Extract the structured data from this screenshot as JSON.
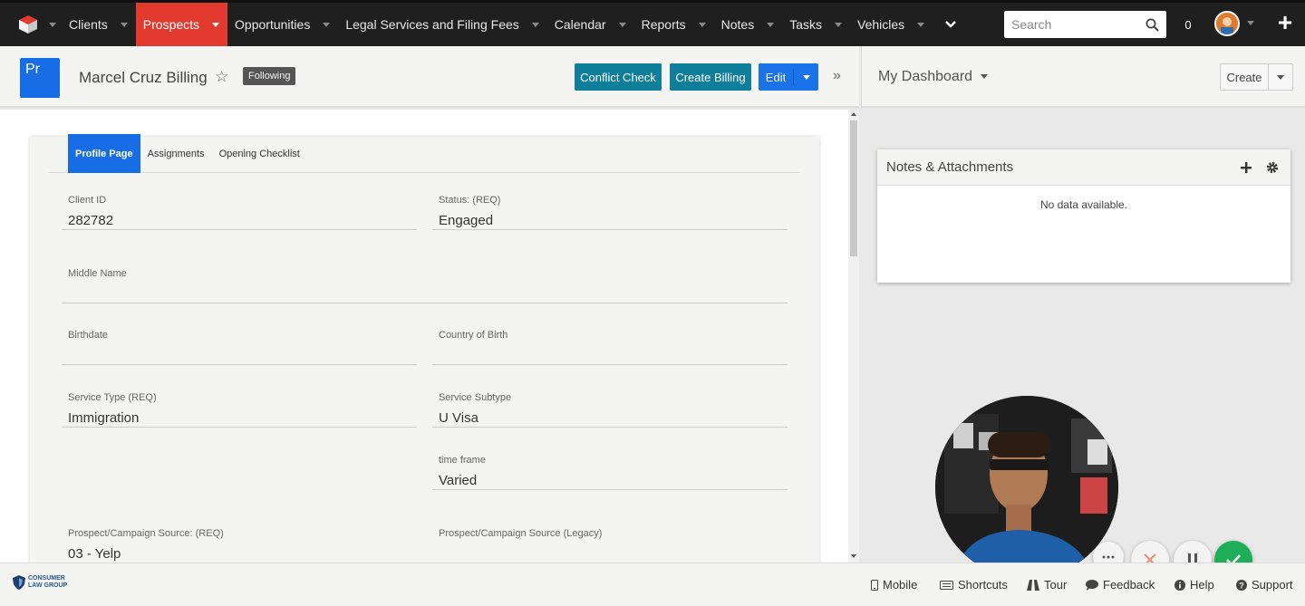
{
  "nav": {
    "items": [
      {
        "label": "Clients",
        "active": false
      },
      {
        "label": "Prospects",
        "active": true
      },
      {
        "label": "Opportunities",
        "active": false
      },
      {
        "label": "Legal Services and Filing Fees",
        "active": false
      },
      {
        "label": "Calendar",
        "active": false
      },
      {
        "label": "Reports",
        "active": false
      },
      {
        "label": "Notes",
        "active": false
      },
      {
        "label": "Tasks",
        "active": false
      },
      {
        "label": "Vehicles",
        "active": false
      }
    ],
    "search_placeholder": "Search",
    "notification_count": "0",
    "active_color": "#e23a2f"
  },
  "record": {
    "icon_text": "Pr",
    "title": "Marcel Cruz Billing",
    "following_label": "Following",
    "buttons": {
      "conflict_check": "Conflict Check",
      "create_billing": "Create Billing",
      "edit": "Edit"
    },
    "tabs": [
      "Profile Page",
      "Assignments",
      "Opening Checklist"
    ],
    "fields": {
      "client_id": {
        "label": "Client ID",
        "value": "282782"
      },
      "status": {
        "label": "Status: (REQ)",
        "value": "Engaged"
      },
      "middle_name": {
        "label": "Middle Name",
        "value": ""
      },
      "birthdate": {
        "label": "Birthdate",
        "value": ""
      },
      "country_of_birth": {
        "label": "Country of Birth",
        "value": ""
      },
      "service_type": {
        "label": "Service Type (REQ)",
        "value": "Immigration"
      },
      "service_subtype": {
        "label": "Service Subtype",
        "value": "U Visa"
      },
      "time_frame": {
        "label": "time frame",
        "value": "Varied"
      },
      "campaign_source": {
        "label": "Prospect/Campaign Source: (REQ)",
        "value": "03 - Yelp"
      },
      "campaign_source_legacy": {
        "label": "Prospect/Campaign Source (Legacy)",
        "value": ""
      }
    }
  },
  "dashboard": {
    "title": "My Dashboard",
    "create_label": "Create",
    "dashlet": {
      "title": "Notes & Attachments",
      "empty_text": "No data available."
    }
  },
  "footer": {
    "logo_text_1": "CONSUMER",
    "logo_text_2": "LAW GROUP",
    "links": {
      "mobile": "Mobile",
      "shortcuts": "Shortcuts",
      "tour": "Tour",
      "feedback": "Feedback",
      "help": "Help",
      "support": "Support"
    }
  }
}
